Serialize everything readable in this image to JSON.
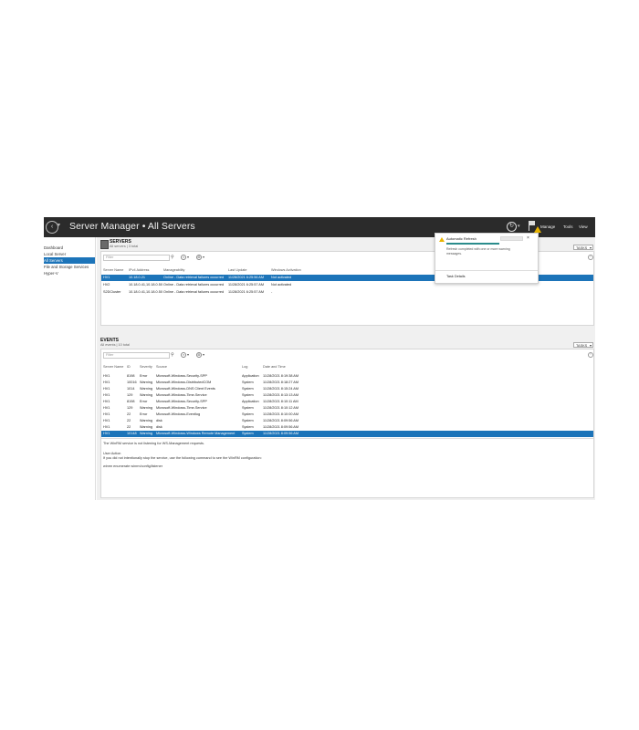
{
  "app": {
    "title": "Server Manager • All Servers",
    "menus": [
      "Manage",
      "Tools",
      "View"
    ]
  },
  "nav": {
    "items": [
      {
        "label": "Dashboard",
        "selected": false
      },
      {
        "label": "Local Server",
        "selected": false
      },
      {
        "label": "All Servers",
        "selected": true
      },
      {
        "label": "File and Storage Services",
        "selected": false
      },
      {
        "label": "Hyper-V",
        "selected": false
      }
    ]
  },
  "servers": {
    "heading": "SERVERS",
    "subheading": "All servers | 3 total",
    "tasks_label": "TASKS",
    "filter_placeholder": "Filter",
    "columns": [
      "Server Name",
      "IPv4 Address",
      "Manageability",
      "Last Update",
      "Windows Activation"
    ],
    "rows": [
      {
        "cells": [
          "HV1",
          "10.18.0.21",
          "Online - Data retrieval failures occurred",
          "11/28/2021 6:25:56 AM",
          "Not activated"
        ],
        "selected": true
      },
      {
        "cells": [
          "HV2",
          "10.18.0.41,10.18.0.50",
          "Online - Data retrieval failures occurred",
          "11/28/2021 6:25:57 AM",
          "Not activated"
        ],
        "selected": false
      },
      {
        "cells": [
          "S2DCluster",
          "10.18.0.41,10.18.0.50",
          "Online - Data retrieval failures occurred",
          "11/28/2021 6:25:57 AM",
          "-"
        ],
        "selected": false
      }
    ]
  },
  "events": {
    "heading": "EVENTS",
    "subheading": "All events | 10 total",
    "tasks_label": "TASKS",
    "filter_placeholder": "Filter",
    "columns": [
      "Server Name",
      "ID",
      "Severity",
      "Source",
      "Log",
      "Date and Time"
    ],
    "rows": [
      {
        "cells": [
          "HV1",
          "8198",
          "Error",
          "Microsoft-Windows-Security-SPP",
          "Application",
          "11/28/2021 8:19:38 AM"
        ],
        "selected": false
      },
      {
        "cells": [
          "HV1",
          "10016",
          "Warning",
          "Microsoft-Windows-DistributedCOM",
          "System",
          "11/28/2021 8:18:27 AM"
        ],
        "selected": false
      },
      {
        "cells": [
          "HV1",
          "1014",
          "Warning",
          "Microsoft-Windows-DNS Client Events",
          "System",
          "11/28/2021 8:15:24 AM"
        ],
        "selected": false
      },
      {
        "cells": [
          "HV1",
          "129",
          "Warning",
          "Microsoft-Windows-Time-Service",
          "System",
          "11/28/2021 8:13:13 AM"
        ],
        "selected": false
      },
      {
        "cells": [
          "HV1",
          "8198",
          "Error",
          "Microsoft-Windows-Security-SPP",
          "Application",
          "11/28/2021 8:10:11 AM"
        ],
        "selected": false
      },
      {
        "cells": [
          "HV1",
          "129",
          "Warning",
          "Microsoft-Windows-Time-Service",
          "System",
          "11/28/2021 8:10:12 AM"
        ],
        "selected": false
      },
      {
        "cells": [
          "HV1",
          "22",
          "Error",
          "Microsoft-Windows-Eventlog",
          "System",
          "11/28/2021 8:10:00 AM"
        ],
        "selected": false
      },
      {
        "cells": [
          "HV1",
          "22",
          "Warning",
          "disk",
          "System",
          "11/28/2021 8:09:56 AM"
        ],
        "selected": false
      },
      {
        "cells": [
          "HV1",
          "22",
          "Warning",
          "disk",
          "System",
          "11/28/2021 8:09:56 AM"
        ],
        "selected": false
      },
      {
        "cells": [
          "HV1",
          "10148",
          "Warning",
          "Microsoft-Windows-Windows Remote Management",
          "System",
          "11/28/2021 8:09:56 AM"
        ],
        "selected": true
      }
    ],
    "detail": {
      "message": "The WinRM service is not listening for WS-Management requests.",
      "user_action_label": "User Action",
      "user_action_text": "If you did not intentionally stop the service, use the following command to see the WinRM configuration:",
      "command": "winrm enumerate winrm/config/listener"
    }
  },
  "notification": {
    "title": "Automatic Refresh",
    "progress": 1.0,
    "message": "Refresh completed with one or more warning messages.",
    "link": "Task Details"
  },
  "colors": {
    "titlebar": "#2b2b2b",
    "selection": "#1c74b9",
    "warning": "#e8b400",
    "progress": "#2a8c8c"
  }
}
